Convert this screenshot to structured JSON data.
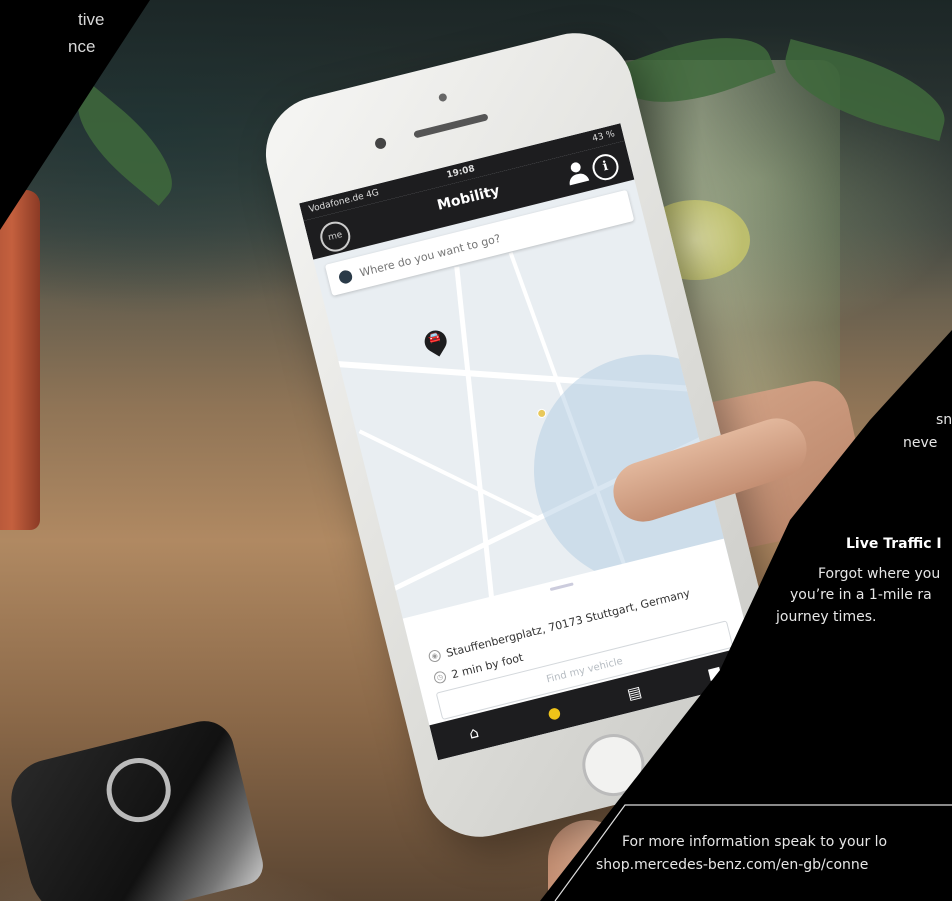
{
  "overlay": {
    "top_left_lines": [
      "tive",
      "nce"
    ],
    "right_lines": [
      "sn",
      "neve"
    ],
    "live_title": "Live Traffic I",
    "live_lines": [
      "Forgot where you",
      "you’re in a 1-mile ra",
      "journey times."
    ],
    "footer_lines": [
      "For more information speak to your lo",
      "shop.mercedes-benz.com/en-gb/conne"
    ]
  },
  "phone": {
    "status": {
      "carrier": "Vodafone.de 4G",
      "time": "19:08",
      "battery": "43 %"
    },
    "nav": {
      "title": "Mobility",
      "logo": "me"
    },
    "search": {
      "placeholder": "Where do you want to go?"
    },
    "location": {
      "address": "Stauffenbergplatz, 70173 Stuttgart, Germany",
      "walk_time": "2 min by foot",
      "find_button": "Find my vehicle"
    },
    "tabs": [
      "home-icon",
      "location-pin-icon",
      "document-icon",
      "shopping-bag-icon"
    ],
    "active_tab": "location-pin-icon",
    "accent_color": "#f0c419"
  }
}
